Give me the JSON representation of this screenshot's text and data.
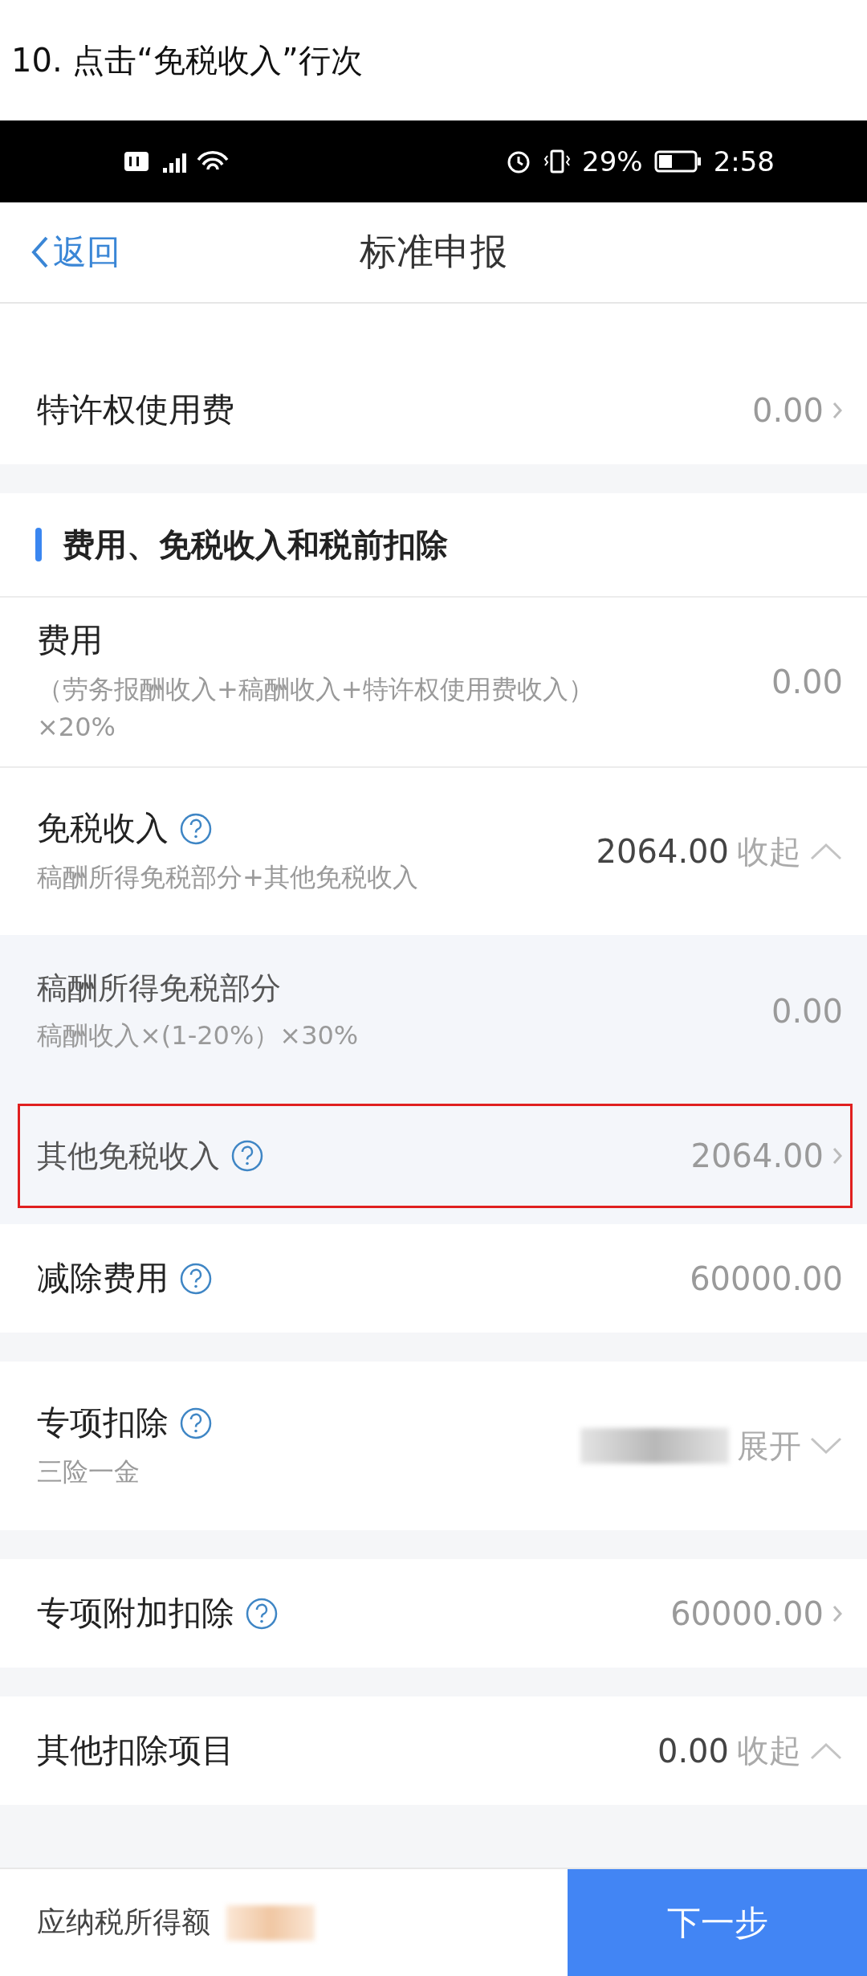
{
  "caption": "10. 点击“免税收入”行次",
  "status_bar": {
    "battery": "29%",
    "time": "2:58"
  },
  "header": {
    "back": "返回",
    "title": "标准申报"
  },
  "sections": [
    {
      "rows": [
        {
          "kind": "link",
          "label": "特许权使用费",
          "value": "0.00"
        }
      ]
    },
    {
      "heading": "费用、免税收入和税前扣除",
      "rows": [
        {
          "kind": "plain",
          "label": "费用",
          "note": "（劳务报酬收入+稿酬收入+特许权使用费收入）×20%",
          "value": "0.00"
        },
        {
          "kind": "toggle",
          "label": "免税收入",
          "help": true,
          "note": "稿酬所得免税部分+其他免税收入",
          "value": "2064.00",
          "action": "收起",
          "expanded": true,
          "children": [
            {
              "kind": "plain",
              "label": "稿酬所得免税部分",
              "note": "稿酬收入×(1-20%）×30%",
              "value": "0.00"
            },
            {
              "kind": "link",
              "label": "其他免税收入",
              "help": true,
              "value": "2064.00",
              "highlighted": true
            }
          ]
        },
        {
          "kind": "plain",
          "label": "减除费用",
          "help": true,
          "value": "60000.00"
        }
      ]
    },
    {
      "rows": [
        {
          "kind": "toggle",
          "label": "专项扣除",
          "help": true,
          "note": "三险一金",
          "redacted": true,
          "action": "展开",
          "expanded": false
        }
      ]
    },
    {
      "rows": [
        {
          "kind": "link",
          "label": "专项附加扣除",
          "help": true,
          "value": "60000.00"
        }
      ]
    },
    {
      "rows": [
        {
          "kind": "toggle",
          "label": "其他扣除项目",
          "value": "0.00",
          "action": "收起",
          "expanded": true
        }
      ]
    }
  ],
  "footer": {
    "label": "应纳税所得额",
    "redacted": true,
    "button": "下一步"
  }
}
